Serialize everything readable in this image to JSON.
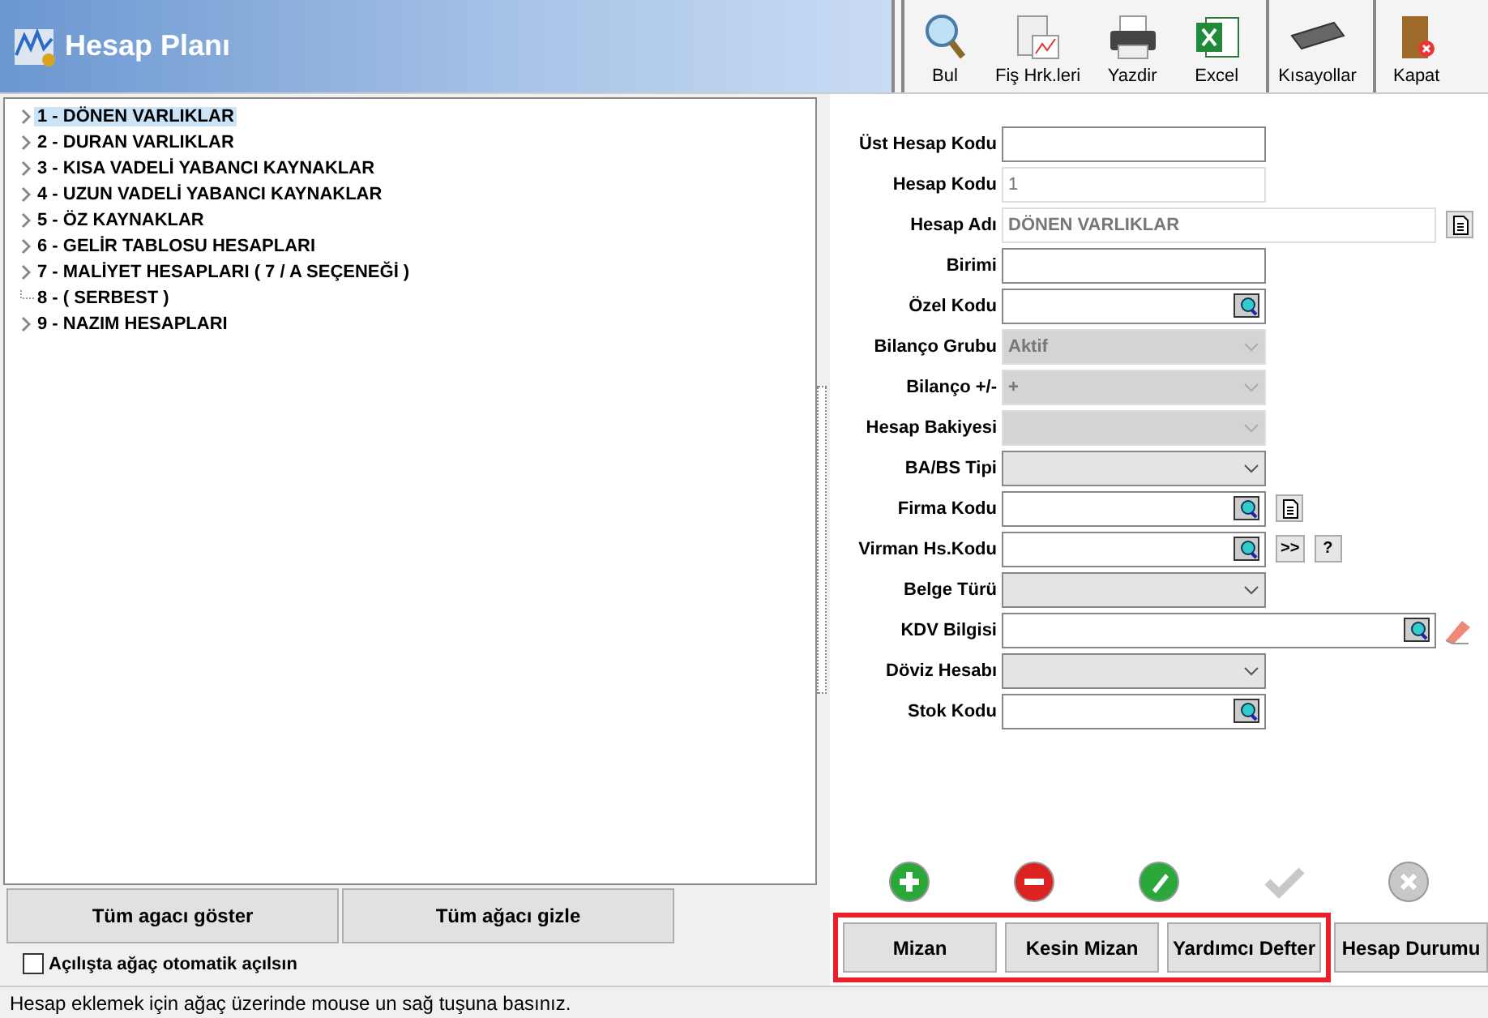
{
  "window": {
    "title": "Hesap Planı"
  },
  "toolbar": [
    {
      "kind": "search",
      "label": "Bul"
    },
    {
      "kind": "report",
      "label": "Fiş Hrk.leri"
    },
    {
      "kind": "print",
      "label": "Yazdir"
    },
    {
      "kind": "excel",
      "label": "Excel"
    },
    {
      "kind": "keyboard",
      "label": "Kısayollar"
    },
    {
      "kind": "exit",
      "label": "Kapat"
    }
  ],
  "tree": [
    {
      "label": "1 - DÖNEN VARLIKLAR",
      "selected": true,
      "expandable": true
    },
    {
      "label": "2 - DURAN VARLIKLAR",
      "selected": false,
      "expandable": true
    },
    {
      "label": "3 - KISA VADELİ YABANCI KAYNAKLAR",
      "selected": false,
      "expandable": true
    },
    {
      "label": "4 - UZUN VADELİ YABANCI KAYNAKLAR",
      "selected": false,
      "expandable": true
    },
    {
      "label": "5 - ÖZ KAYNAKLAR",
      "selected": false,
      "expandable": true
    },
    {
      "label": "6 - GELİR TABLOSU HESAPLARI",
      "selected": false,
      "expandable": true
    },
    {
      "label": "7 - MALİYET HESAPLARI ( 7 / A  SEÇENEĞİ )",
      "selected": false,
      "expandable": true
    },
    {
      "label": "8 - ( SERBEST )",
      "selected": false,
      "expandable": false
    },
    {
      "label": "9 - NAZIM HESAPLARI",
      "selected": false,
      "expandable": true
    }
  ],
  "tree_buttons": [
    "Tüm agacı göster",
    "Tüm ağacı gizle"
  ],
  "auto_expand": {
    "label": "Açılışta ağaç otomatik açılsın",
    "checked": false
  },
  "form": [
    {
      "label": "Üst Hesap Kodu",
      "kind": "text",
      "wide": false,
      "disabled": false
    },
    {
      "label": "Hesap Kodu",
      "kind": "text",
      "value": "1",
      "wide": false,
      "disabled": true
    },
    {
      "label": "Hesap Adı",
      "kind": "text",
      "value": "DÖNEN VARLIKLAR",
      "wide": true,
      "disabled": true,
      "extras": [
        {
          "kind": "note"
        }
      ]
    },
    {
      "label": "Birimi",
      "kind": "text",
      "wide": false,
      "disabled": false
    },
    {
      "label": "Özel Kodu",
      "kind": "lookup",
      "wide": false,
      "disabled": false
    },
    {
      "label": "Bilanço Grubu",
      "kind": "combo",
      "value": "Aktif",
      "wide": false,
      "disabled": true
    },
    {
      "label": "Bilanço +/-",
      "kind": "combo",
      "value": "+",
      "wide": false,
      "disabled": true
    },
    {
      "label": "Hesap Bakiyesi",
      "kind": "combo",
      "wide": false,
      "disabled": true
    },
    {
      "label": "BA/BS Tipi",
      "kind": "combo",
      "wide": false,
      "disabled": false
    },
    {
      "label": "Firma Kodu",
      "kind": "lookup",
      "wide": false,
      "disabled": false,
      "extras": [
        {
          "kind": "note"
        }
      ]
    },
    {
      "label": "Virman Hs.Kodu",
      "kind": "lookup",
      "wide": false,
      "disabled": false,
      "extras": [
        {
          "kind": "text",
          "label": ">>"
        },
        {
          "kind": "text",
          "label": "?"
        }
      ]
    },
    {
      "label": "Belge Türü",
      "kind": "combo",
      "wide": false,
      "disabled": false
    },
    {
      "label": "KDV Bilgisi",
      "kind": "lookup",
      "wide": true,
      "disabled": false,
      "extras": [
        {
          "kind": "eraser"
        }
      ]
    },
    {
      "label": "Döviz Hesabı",
      "kind": "combo",
      "wide": false,
      "disabled": false
    },
    {
      "label": "Stok Kodu",
      "kind": "lookup",
      "wide": false,
      "disabled": false
    }
  ],
  "actions": [
    {
      "kind": "add",
      "disabled": false
    },
    {
      "kind": "delete",
      "disabled": false
    },
    {
      "kind": "edit",
      "disabled": false
    },
    {
      "kind": "confirm",
      "disabled": true
    },
    {
      "kind": "cancel",
      "disabled": true
    }
  ],
  "report_buttons": [
    {
      "label": "Mizan",
      "highlighted": true
    },
    {
      "label": "Kesin Mizan",
      "highlighted": true
    },
    {
      "label": "Yardımcı Defter",
      "highlighted": true
    },
    {
      "label": "Hesap Durumu",
      "highlighted": false
    }
  ],
  "status_bar": "Hesap eklemek için ağaç üzerinde mouse un sağ tuşuna basınız."
}
